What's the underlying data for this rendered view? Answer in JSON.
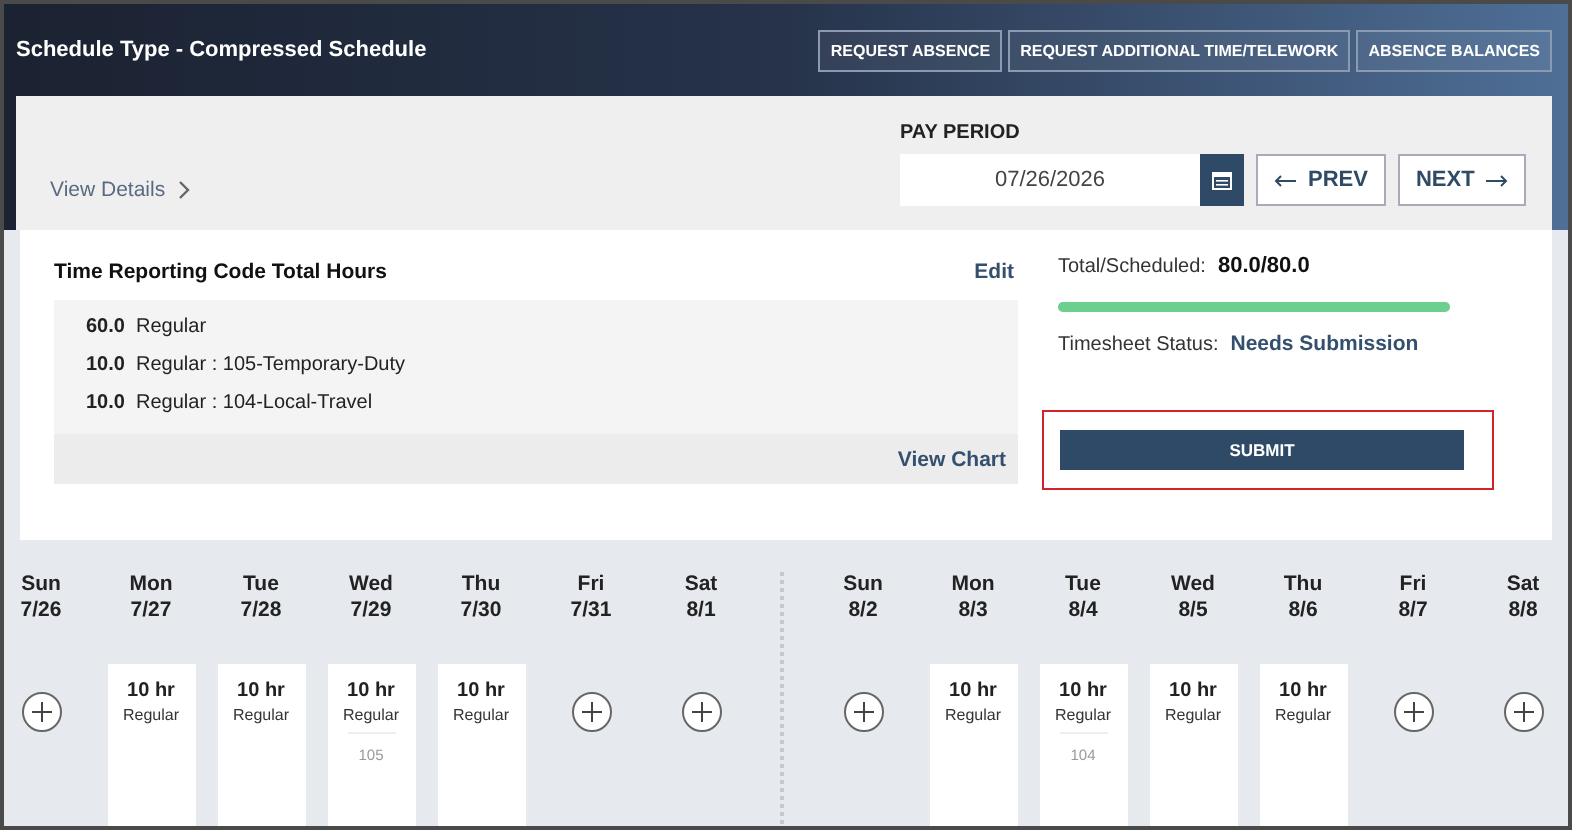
{
  "header": {
    "title": "Schedule Type -  Compressed Schedule",
    "buttons": [
      "REQUEST ABSENCE",
      "REQUEST ADDITIONAL TIME/TELEWORK",
      "ABSENCE BALANCES"
    ]
  },
  "view_details": "View Details",
  "pay_period": {
    "label": "PAY PERIOD",
    "value": "07/26/2026",
    "prev": "PREV",
    "next": "NEXT"
  },
  "hours_summary": {
    "title": "Time Reporting Code Total Hours",
    "edit": "Edit",
    "view_chart": "View Chart",
    "lines": [
      {
        "hours": "60.0",
        "code": "Regular"
      },
      {
        "hours": "10.0",
        "code": "Regular : 105-Temporary-Duty"
      },
      {
        "hours": "10.0",
        "code": "Regular : 104-Local-Travel"
      }
    ]
  },
  "totals": {
    "label": "Total/Scheduled:",
    "value": "80.0/80.0",
    "level": 1.0,
    "status_label": "Timesheet Status:",
    "status": "Needs Submission"
  },
  "submit": {
    "label": "SUBMIT",
    "highlighted": true
  },
  "weeks": [
    {
      "days": [
        {
          "weekday": "Sun",
          "date": "7/26",
          "kind": "add"
        },
        {
          "weekday": "Mon",
          "date": "7/27",
          "kind": "entry",
          "hours": "10 hr",
          "code": "Regular"
        },
        {
          "weekday": "Tue",
          "date": "7/28",
          "kind": "entry",
          "hours": "10 hr",
          "code": "Regular"
        },
        {
          "weekday": "Wed",
          "date": "7/29",
          "kind": "entry",
          "hours": "10 hr",
          "code": "Regular",
          "note": "105"
        },
        {
          "weekday": "Thu",
          "date": "7/30",
          "kind": "entry",
          "hours": "10 hr",
          "code": "Regular"
        },
        {
          "weekday": "Fri",
          "date": "7/31",
          "kind": "add"
        },
        {
          "weekday": "Sat",
          "date": "8/1",
          "kind": "add"
        }
      ]
    },
    {
      "days": [
        {
          "weekday": "Sun",
          "date": "8/2",
          "kind": "add"
        },
        {
          "weekday": "Mon",
          "date": "8/3",
          "kind": "entry",
          "hours": "10 hr",
          "code": "Regular"
        },
        {
          "weekday": "Tue",
          "date": "8/4",
          "kind": "entry",
          "hours": "10 hr",
          "code": "Regular",
          "note": "104"
        },
        {
          "weekday": "Wed",
          "date": "8/5",
          "kind": "entry",
          "hours": "10 hr",
          "code": "Regular"
        },
        {
          "weekday": "Thu",
          "date": "8/6",
          "kind": "entry",
          "hours": "10 hr",
          "code": "Regular"
        },
        {
          "weekday": "Fri",
          "date": "8/7",
          "kind": "add"
        },
        {
          "weekday": "Sat",
          "date": "8/8",
          "kind": "add"
        }
      ]
    }
  ]
}
